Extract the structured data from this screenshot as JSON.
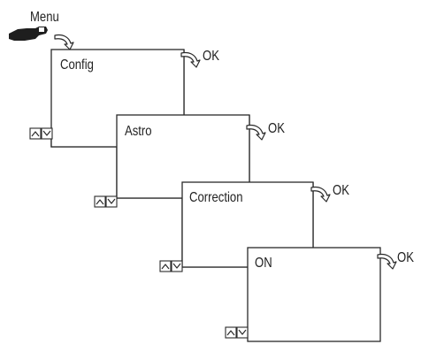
{
  "menu_key": {
    "label": "Menu",
    "icon": "pointing-hand-icon"
  },
  "ok_key_label": "OK",
  "screens": [
    {
      "label": "Config"
    },
    {
      "label": "Astro"
    },
    {
      "label": "Correction"
    },
    {
      "label": "ON"
    }
  ],
  "nav_buttons": {
    "up_icon": "up-arrow-icon",
    "down_icon": "down-arrow-icon"
  }
}
